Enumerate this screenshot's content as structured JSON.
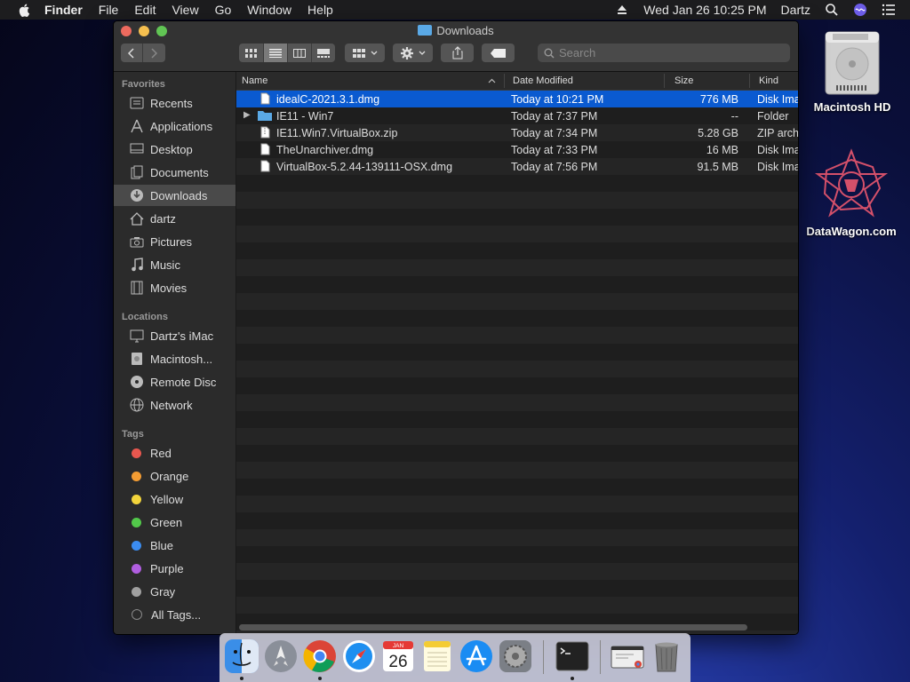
{
  "menubar": {
    "app": "Finder",
    "items": [
      "File",
      "Edit",
      "View",
      "Go",
      "Window",
      "Help"
    ],
    "datetime": "Wed Jan 26  10:25 PM",
    "user": "Dartz"
  },
  "window": {
    "title": "Downloads",
    "search_placeholder": "Search"
  },
  "sidebar": {
    "favorites_header": "Favorites",
    "favorites": [
      "Recents",
      "Applications",
      "Desktop",
      "Documents",
      "Downloads",
      "dartz",
      "Pictures",
      "Music",
      "Movies"
    ],
    "locations_header": "Locations",
    "locations": [
      "Dartz's iMac",
      "Macintosh...",
      "Remote Disc",
      "Network"
    ],
    "tags_header": "Tags",
    "tags": [
      {
        "label": "Red",
        "color": "#e9574f"
      },
      {
        "label": "Orange",
        "color": "#f39c33"
      },
      {
        "label": "Yellow",
        "color": "#f2d43b"
      },
      {
        "label": "Green",
        "color": "#52c84a"
      },
      {
        "label": "Blue",
        "color": "#3b8cf0"
      },
      {
        "label": "Purple",
        "color": "#b05ee0"
      },
      {
        "label": "Gray",
        "color": "#a0a0a0"
      },
      {
        "label": "All Tags...",
        "color": "#555555"
      }
    ]
  },
  "columns": {
    "name": "Name",
    "date": "Date Modified",
    "size": "Size",
    "kind": "Kind"
  },
  "files": [
    {
      "name": "idealC-2021.3.1.dmg",
      "date": "Today at 10:21 PM",
      "size": "776 MB",
      "kind": "Disk Ima"
    },
    {
      "name": "IE11 - Win7",
      "date": "Today at 7:37 PM",
      "size": "--",
      "kind": "Folder"
    },
    {
      "name": "IE11.Win7.VirtualBox.zip",
      "date": "Today at 7:34 PM",
      "size": "5.28 GB",
      "kind": "ZIP arch"
    },
    {
      "name": "TheUnarchiver.dmg",
      "date": "Today at 7:33 PM",
      "size": "16 MB",
      "kind": "Disk Ima"
    },
    {
      "name": "VirtualBox-5.2.44-139111-OSX.dmg",
      "date": "Today at 7:56 PM",
      "size": "91.5 MB",
      "kind": "Disk Ima"
    }
  ],
  "desktop": {
    "hd_label": "Macintosh HD",
    "dw_label": "DataWagon.com"
  },
  "dock": {
    "calendar_month": "JAN",
    "calendar_day": "26"
  }
}
